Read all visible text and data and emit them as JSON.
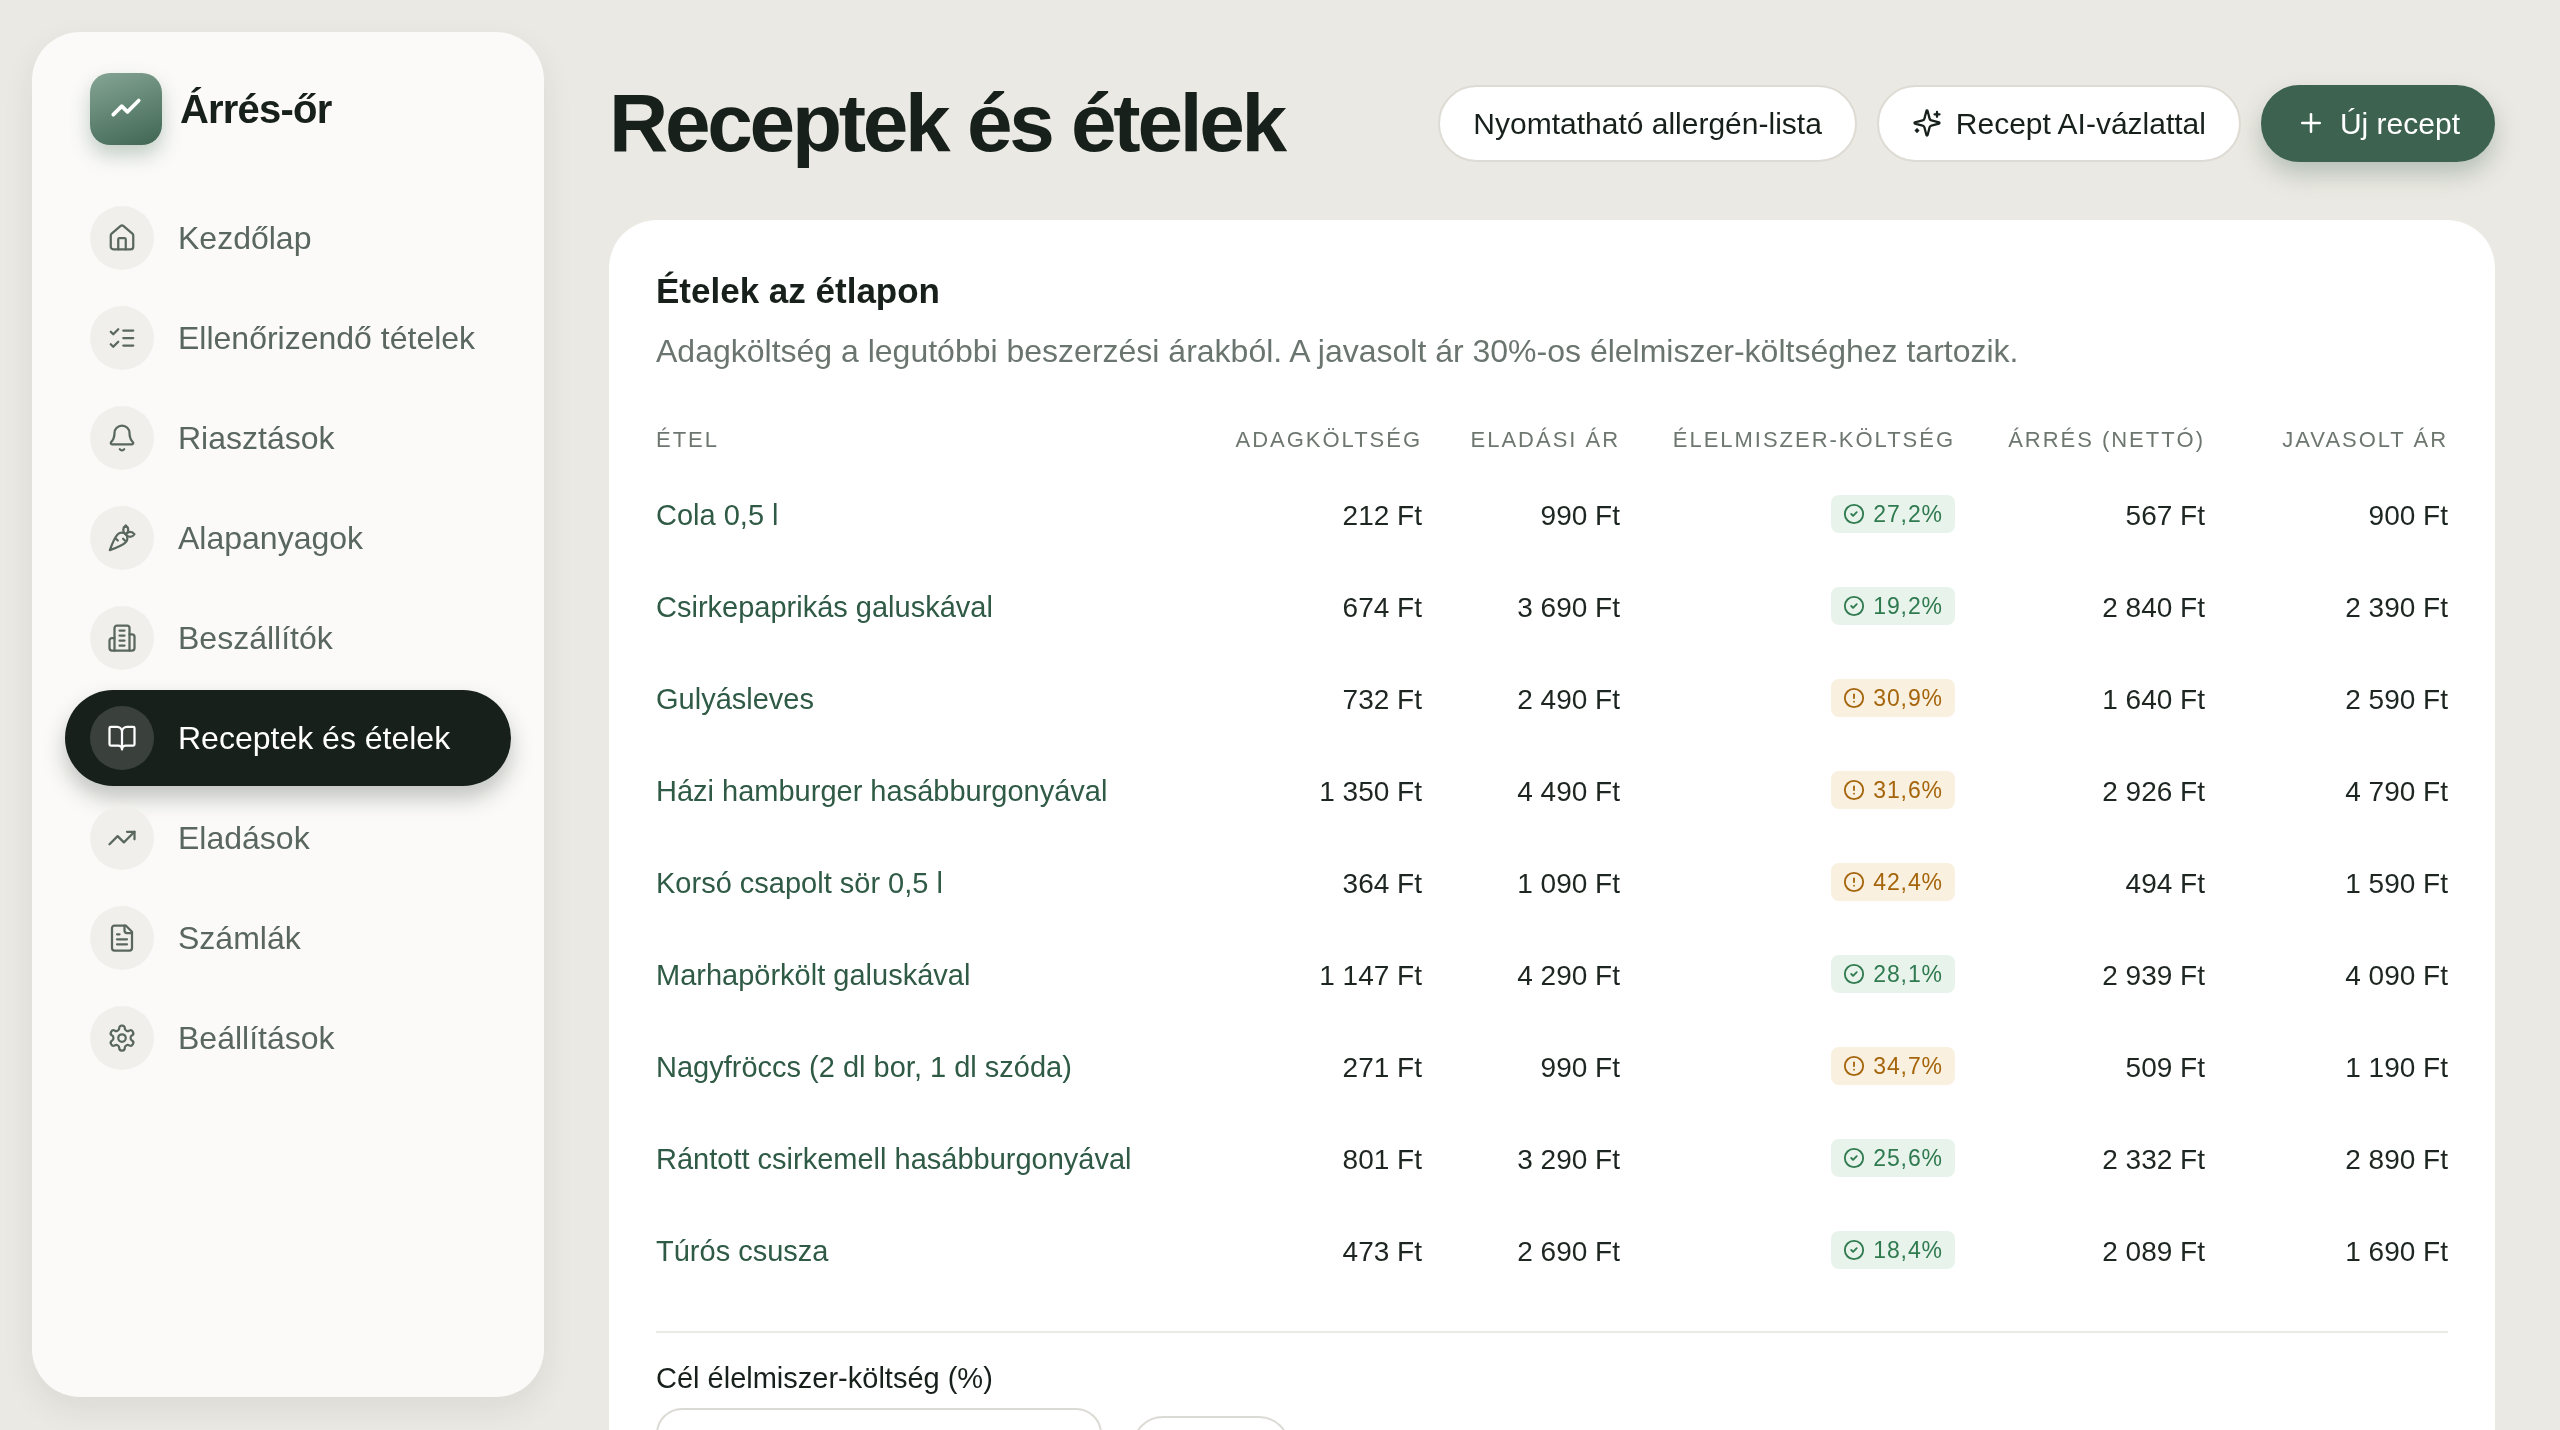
{
  "sidebar": {
    "brand": "Árrés-őr",
    "items": [
      {
        "label": "Kezdőlap",
        "selected": false
      },
      {
        "label": "Ellenőrizendő tételek",
        "selected": false
      },
      {
        "label": "Riasztások",
        "selected": false
      },
      {
        "label": "Alapanyagok",
        "selected": false
      },
      {
        "label": "Beszállítók",
        "selected": false
      },
      {
        "label": "Receptek és ételek",
        "selected": true
      },
      {
        "label": "Eladások",
        "selected": false
      },
      {
        "label": "Számlák",
        "selected": false
      },
      {
        "label": "Beállítások",
        "selected": false
      }
    ]
  },
  "header": {
    "title": "Receptek és ételek",
    "buttons": [
      {
        "label": "Nyomtatható allergén-lista",
        "kind": "outline"
      },
      {
        "label": "Recept AI-vázlattal",
        "kind": "assist"
      },
      {
        "label": "Új recept",
        "kind": "primary"
      }
    ]
  },
  "menu_card": {
    "title": "Ételek az étlapon",
    "subtitle": "Adagköltség a legutóbbi beszerzési árakból. A javasolt ár 30%-os élelmiszer-költséghez tartozik.",
    "table": {
      "columns": [
        "ÉTEL",
        "ADAGKÖLTSÉG",
        "ELADÁSI ÁR",
        "ÉLELMISZER-KÖLTSÉG",
        "ÁRRÉS (NETTÓ)",
        "JAVASOLT ÁR"
      ],
      "rows": [
        {
          "dish": "Cola 0,5 l",
          "portion_cost": "212 Ft",
          "sale_price": "990 Ft",
          "food_cost": "27,2%",
          "over_target": false,
          "margin": "567 Ft",
          "suggested_price": "900 Ft"
        },
        {
          "dish": "Csirkepaprikás galuskával",
          "portion_cost": "674 Ft",
          "sale_price": "3 690 Ft",
          "food_cost": "19,2%",
          "over_target": false,
          "margin": "2 840 Ft",
          "suggested_price": "2 390 Ft"
        },
        {
          "dish": "Gulyásleves",
          "portion_cost": "732 Ft",
          "sale_price": "2 490 Ft",
          "food_cost": "30,9%",
          "over_target": true,
          "margin": "1 640 Ft",
          "suggested_price": "2 590 Ft"
        },
        {
          "dish": "Házi hamburger hasábburgonyával",
          "portion_cost": "1 350 Ft",
          "sale_price": "4 490 Ft",
          "food_cost": "31,6%",
          "over_target": true,
          "margin": "2 926 Ft",
          "suggested_price": "4 790 Ft"
        },
        {
          "dish": "Korsó csapolt sör 0,5 l",
          "portion_cost": "364 Ft",
          "sale_price": "1 090 Ft",
          "food_cost": "42,4%",
          "over_target": true,
          "margin": "494 Ft",
          "suggested_price": "1 590 Ft"
        },
        {
          "dish": "Marhapörkölt galuskával",
          "portion_cost": "1 147 Ft",
          "sale_price": "4 290 Ft",
          "food_cost": "28,1%",
          "over_target": false,
          "margin": "2 939 Ft",
          "suggested_price": "4 090 Ft"
        },
        {
          "dish": "Nagyfröccs (2 dl bor, 1 dl szóda)",
          "portion_cost": "271 Ft",
          "sale_price": "990 Ft",
          "food_cost": "34,7%",
          "over_target": true,
          "margin": "509 Ft",
          "suggested_price": "1 190 Ft"
        },
        {
          "dish": "Rántott csirkemell hasábburgonyával",
          "portion_cost": "801 Ft",
          "sale_price": "3 290 Ft",
          "food_cost": "25,6%",
          "over_target": false,
          "margin": "2 332 Ft",
          "suggested_price": "2 890 Ft"
        },
        {
          "dish": "Túrós csusza",
          "portion_cost": "473 Ft",
          "sale_price": "2 690 Ft",
          "food_cost": "18,4%",
          "over_target": false,
          "margin": "2 089 Ft",
          "suggested_price": "1 690 Ft"
        }
      ]
    },
    "target_form": {
      "label": "Cél élelmiszer-költség (%)"
    }
  }
}
